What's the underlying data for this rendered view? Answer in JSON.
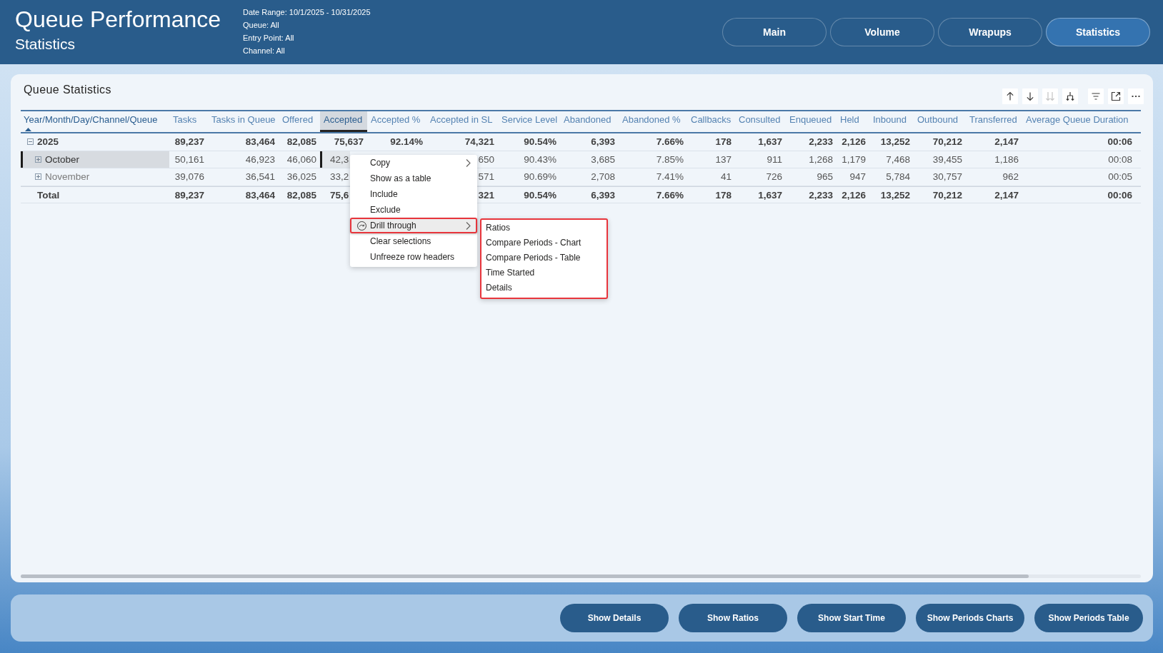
{
  "header": {
    "title": "Queue Performance",
    "subtitle": "Statistics",
    "filters": [
      "Date Range: 10/1/2025 - 10/31/2025",
      "Queue: All",
      "Entry Point: All",
      "Channel: All"
    ]
  },
  "nav_tabs": [
    {
      "label": "Main",
      "selected": false
    },
    {
      "label": "Volume",
      "selected": false
    },
    {
      "label": "Wrapups",
      "selected": false
    },
    {
      "label": "Statistics",
      "selected": true
    }
  ],
  "table_card": {
    "title": "Queue Statistics",
    "toolbar": [
      {
        "kind": "sort-up",
        "disabled": false
      },
      {
        "kind": "sort-down",
        "disabled": false
      },
      {
        "kind": "expand-all",
        "disabled": true
      },
      {
        "kind": "expand-next",
        "disabled": false
      },
      {
        "kind": "filter",
        "disabled": false
      },
      {
        "kind": "focus",
        "disabled": false
      },
      {
        "kind": "more",
        "disabled": false
      }
    ],
    "columns": [
      {
        "label": "Year/Month/Day/Channel/Queue",
        "sorted": true,
        "selected": false
      },
      {
        "label": "Tasks",
        "sorted": false,
        "selected": false
      },
      {
        "label": "Tasks in Queue",
        "sorted": false,
        "selected": false
      },
      {
        "label": "Offered",
        "sorted": false,
        "selected": false
      },
      {
        "label": "Accepted",
        "sorted": false,
        "selected": true
      },
      {
        "label": "Accepted %",
        "sorted": false,
        "selected": false
      },
      {
        "label": "Accepted in SL",
        "sorted": false,
        "selected": false
      },
      {
        "label": "Service Level",
        "sorted": false,
        "selected": false
      },
      {
        "label": "Abandoned",
        "sorted": false,
        "selected": false
      },
      {
        "label": "Abandoned %",
        "sorted": false,
        "selected": false
      },
      {
        "label": "Callbacks",
        "sorted": false,
        "selected": false
      },
      {
        "label": "Consulted",
        "sorted": false,
        "selected": false
      },
      {
        "label": "Enqueued",
        "sorted": false,
        "selected": false
      },
      {
        "label": "Held",
        "sorted": false,
        "selected": false
      },
      {
        "label": "Inbound",
        "sorted": false,
        "selected": false
      },
      {
        "label": "Outbound",
        "sorted": false,
        "selected": false
      },
      {
        "label": "Transferred",
        "sorted": false,
        "selected": false
      },
      {
        "label": "Average Queue Duration",
        "sorted": false,
        "selected": false
      }
    ],
    "rows": [
      {
        "expanded": true,
        "selected": false,
        "cells": [
          "2025",
          "89,237",
          "83,464",
          "82,085",
          "75,637",
          "92.14%",
          "74,321",
          "90.54%",
          "6,393",
          "7.66%",
          "178",
          "1,637",
          "2,233",
          "2,126",
          "13,252",
          "70,212",
          "2,147",
          "00:06"
        ],
        "children": [
          {
            "expanded": false,
            "selected": true,
            "cells": [
              "October",
              "50,161",
              "46,923",
              "46,060",
              {
                "text": "42,3",
                "kind": "clipped-right"
              },
              "",
              {
                "text": "650",
                "kind": "clipped-left"
              },
              "90.43%",
              "3,685",
              "7.85%",
              "137",
              "911",
              "1,268",
              "1,179",
              "7,468",
              "39,455",
              "1,186",
              "00:08"
            ]
          },
          {
            "expanded": false,
            "selected": false,
            "cells": [
              "November",
              "39,076",
              "36,541",
              "36,025",
              {
                "text": "33,2",
                "kind": "clipped-right"
              },
              "",
              {
                "text": "571",
                "kind": "clipped-left"
              },
              "90.69%",
              "2,708",
              "7.41%",
              "41",
              "726",
              "965",
              "947",
              "5,784",
              "30,757",
              "962",
              "00:05"
            ]
          }
        ]
      }
    ],
    "total": {
      "selected": false,
      "cells": [
        "Total",
        "89,237",
        "83,464",
        "82,085",
        {
          "text": "75,6",
          "kind": "clipped-right"
        },
        "",
        {
          "text": "321",
          "kind": "clipped-left"
        },
        "90.54%",
        "6,393",
        "7.66%",
        "178",
        "1,637",
        "2,233",
        "2,126",
        "13,252",
        "70,212",
        "2,147",
        "00:06"
      ]
    }
  },
  "context_menu": {
    "items": [
      {
        "label": "Copy",
        "has_icon": false,
        "submenu": true,
        "open": false,
        "highlighted": false
      },
      {
        "label": "Show as a table",
        "has_icon": false,
        "submenu": false,
        "open": false,
        "highlighted": false
      },
      {
        "label": "Include",
        "has_icon": false,
        "submenu": false,
        "open": false,
        "highlighted": false
      },
      {
        "label": "Exclude",
        "has_icon": false,
        "submenu": false,
        "open": false,
        "highlighted": false
      },
      {
        "label": "Drill through",
        "has_icon": true,
        "submenu": true,
        "open": true,
        "highlighted": true
      },
      {
        "label": "Clear selections",
        "has_icon": false,
        "submenu": false,
        "open": false,
        "highlighted": false
      },
      {
        "label": "Unfreeze row headers",
        "has_icon": false,
        "submenu": false,
        "open": false,
        "highlighted": false
      }
    ],
    "submenu": {
      "highlighted": true,
      "items": [
        "Ratios",
        "Compare Periods - Chart",
        "Compare Periods - Table",
        "Time Started",
        "Details"
      ]
    }
  },
  "actions": [
    "Show Details",
    "Show Ratios",
    "Show Start Time",
    "Show Periods Charts",
    "Show Periods Table"
  ]
}
